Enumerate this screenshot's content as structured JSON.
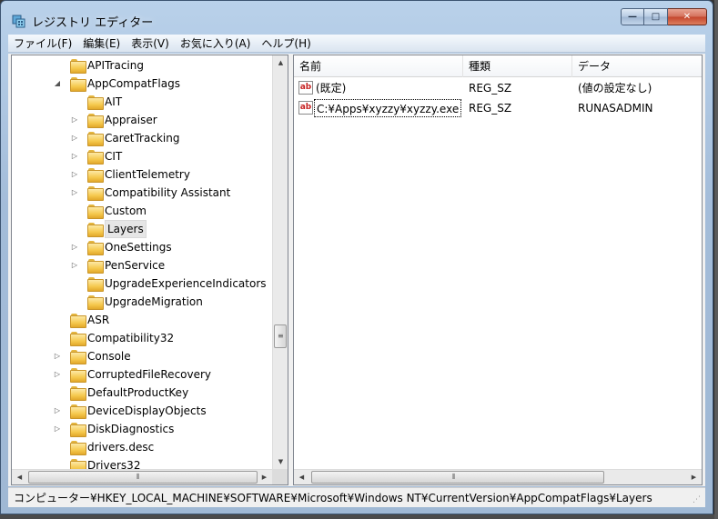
{
  "window": {
    "title": "レジストリ エディター",
    "caption_min": "—",
    "caption_max": "□",
    "caption_close": "✕"
  },
  "menu": [
    "ファイル(F)",
    "編集(E)",
    "表示(V)",
    "お気に入り(A)",
    "ヘルプ(H)"
  ],
  "tree": {
    "nodes": [
      {
        "label": "APITracing",
        "level": 1,
        "expander": ""
      },
      {
        "label": "AppCompatFlags",
        "level": 1,
        "expander": "expanded"
      },
      {
        "label": "AIT",
        "level": 2,
        "expander": ""
      },
      {
        "label": "Appraiser",
        "level": 2,
        "expander": "collapsed"
      },
      {
        "label": "CaretTracking",
        "level": 2,
        "expander": "collapsed"
      },
      {
        "label": "CIT",
        "level": 2,
        "expander": "collapsed"
      },
      {
        "label": "ClientTelemetry",
        "level": 2,
        "expander": "collapsed"
      },
      {
        "label": "Compatibility Assistant",
        "level": 2,
        "expander": "collapsed"
      },
      {
        "label": "Custom",
        "level": 2,
        "expander": ""
      },
      {
        "label": "Layers",
        "level": 2,
        "expander": "",
        "selected": true
      },
      {
        "label": "OneSettings",
        "level": 2,
        "expander": "collapsed"
      },
      {
        "label": "PenService",
        "level": 2,
        "expander": "collapsed"
      },
      {
        "label": "UpgradeExperienceIndicators",
        "level": 2,
        "expander": ""
      },
      {
        "label": "UpgradeMigration",
        "level": 2,
        "expander": ""
      },
      {
        "label": "ASR",
        "level": 1,
        "expander": ""
      },
      {
        "label": "Compatibility32",
        "level": 1,
        "expander": ""
      },
      {
        "label": "Console",
        "level": 1,
        "expander": "collapsed"
      },
      {
        "label": "CorruptedFileRecovery",
        "level": 1,
        "expander": "collapsed"
      },
      {
        "label": "DefaultProductKey",
        "level": 1,
        "expander": ""
      },
      {
        "label": "DeviceDisplayObjects",
        "level": 1,
        "expander": "collapsed"
      },
      {
        "label": "DiskDiagnostics",
        "level": 1,
        "expander": "collapsed"
      },
      {
        "label": "drivers.desc",
        "level": 1,
        "expander": ""
      },
      {
        "label": "Drivers32",
        "level": 1,
        "expander": ""
      }
    ]
  },
  "list": {
    "columns": [
      "名前",
      "種類",
      "データ"
    ],
    "rows": [
      {
        "name": "(既定)",
        "type": "REG_SZ",
        "data": "(値の設定なし)"
      },
      {
        "name": "C:¥Apps¥xyzzy¥xyzzy.exe",
        "type": "REG_SZ",
        "data": "RUNASADMIN"
      }
    ],
    "icon_text": "ab"
  },
  "scroll": {
    "grip": "≡",
    "hgrip": "⦀",
    "up": "▲",
    "down": "▼",
    "left": "◀",
    "right": "▶"
  },
  "status": {
    "path": "コンピューター¥HKEY_LOCAL_MACHINE¥SOFTWARE¥Microsoft¥Windows NT¥CurrentVersion¥AppCompatFlags¥Layers"
  }
}
